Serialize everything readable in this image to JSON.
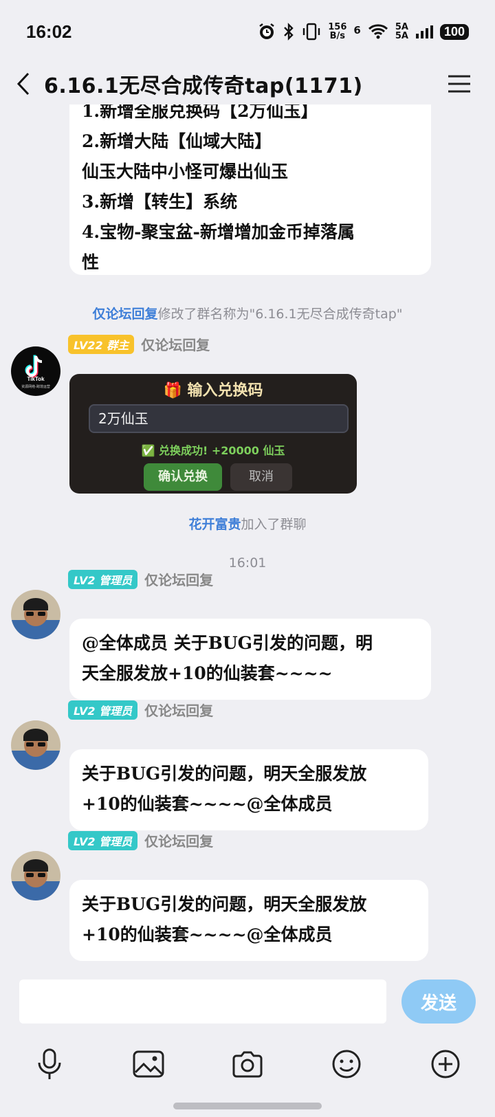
{
  "status_bar": {
    "time": "16:02",
    "net_speed_value": "156",
    "net_speed_unit": "B/s",
    "signal": "6",
    "sim_label_top": "5A",
    "sim_label_bottom": "5A",
    "battery": "100",
    "icons": [
      "alarm-icon",
      "bluetooth-icon",
      "vibrate-icon",
      "wifi-icon",
      "signal-icon"
    ]
  },
  "header": {
    "title": "6.16.1无尽合成传奇tap(1171)"
  },
  "messages": {
    "top_bubble_lines": [
      "1.新增全服兑换码【2万仙玉】",
      "2.新增大陆【仙域大陆】",
      "仙玉大陆中小怪可爆出仙玉",
      "3.新增【转生】系统",
      "4.宝物-聚宝盆-新增增加金币掉落属",
      "性"
    ],
    "system_rename": {
      "name": "仅论坛回复",
      "text": "修改了群名称为\"6.16.1无尽合成传奇tap\""
    },
    "owner_msg": {
      "badge": "LV22 群主",
      "sender": "仅论坛回复",
      "avatar_label": "TikTok",
      "avatar_sub": "资源网络-跨境运营",
      "card": {
        "title": "输入兑换码",
        "input_value": "2万仙玉",
        "success": "兑换成功! +20000 仙玉",
        "confirm": "确认兑换",
        "cancel": "取消"
      }
    },
    "system_join": {
      "name": "花开富贵",
      "text": "加入了群聊"
    },
    "timestamp": "16:01",
    "admin_msgs": [
      {
        "badge": "LV2 管理员",
        "sender": "仅论坛回复",
        "lines": [
          "@全体成员 关于BUG引发的问题，明",
          "天全服发放+10的仙装套~~~~"
        ]
      },
      {
        "badge": "LV2 管理员",
        "sender": "仅论坛回复",
        "lines": [
          "关于BUG引发的问题，明天全服发放",
          "+10的仙装套~~~~@全体成员"
        ]
      },
      {
        "badge": "LV2 管理员",
        "sender": "仅论坛回复",
        "lines": [
          "关于BUG引发的问题，明天全服发放",
          "+10的仙装套~~~~@全体成员"
        ]
      }
    ]
  },
  "input_bar": {
    "placeholder": "",
    "send_label": "发送",
    "tools": [
      "microphone-icon",
      "image-icon",
      "camera-icon",
      "emoji-icon",
      "plus-icon"
    ]
  },
  "colors": {
    "background": "#efeff3",
    "link_blue": "#3f7fd8",
    "owner_badge": "#f8c22b",
    "admin_badge": "#34c8c8",
    "send_button": "#8fcaf5"
  }
}
